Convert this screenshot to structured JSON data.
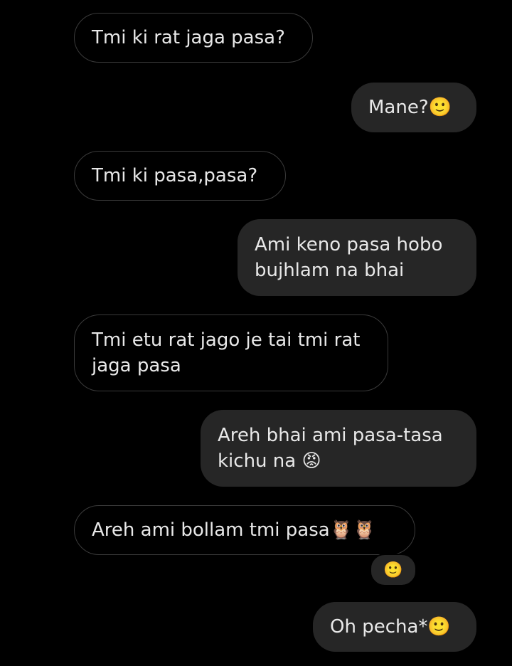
{
  "messages": [
    {
      "side": "incoming",
      "text": "Tmi ki rat jaga pasa?"
    },
    {
      "side": "outgoing",
      "text": "Mane?🙂"
    },
    {
      "side": "incoming",
      "text": "Tmi ki pasa,pasa?"
    },
    {
      "side": "outgoing",
      "text": "Ami keno pasa hobo\nbujhlam na bhai"
    },
    {
      "side": "incoming",
      "text": "Tmi etu rat jago je tai tmi rat\njaga pasa"
    },
    {
      "side": "outgoing",
      "text": "Areh bhai ami pasa-tasa\nkichu na 😡"
    },
    {
      "side": "incoming",
      "text": "Areh ami bollam tmi pasa🦉🦉"
    },
    {
      "side": "outgoing",
      "text": "Oh pecha*🙂"
    }
  ],
  "reaction": {
    "emoji": "🙂"
  },
  "colors": {
    "background": "#000000",
    "outgoing_bubble": "#262626",
    "incoming_border": "#3a3a3a",
    "text": "#e8e8e8"
  }
}
